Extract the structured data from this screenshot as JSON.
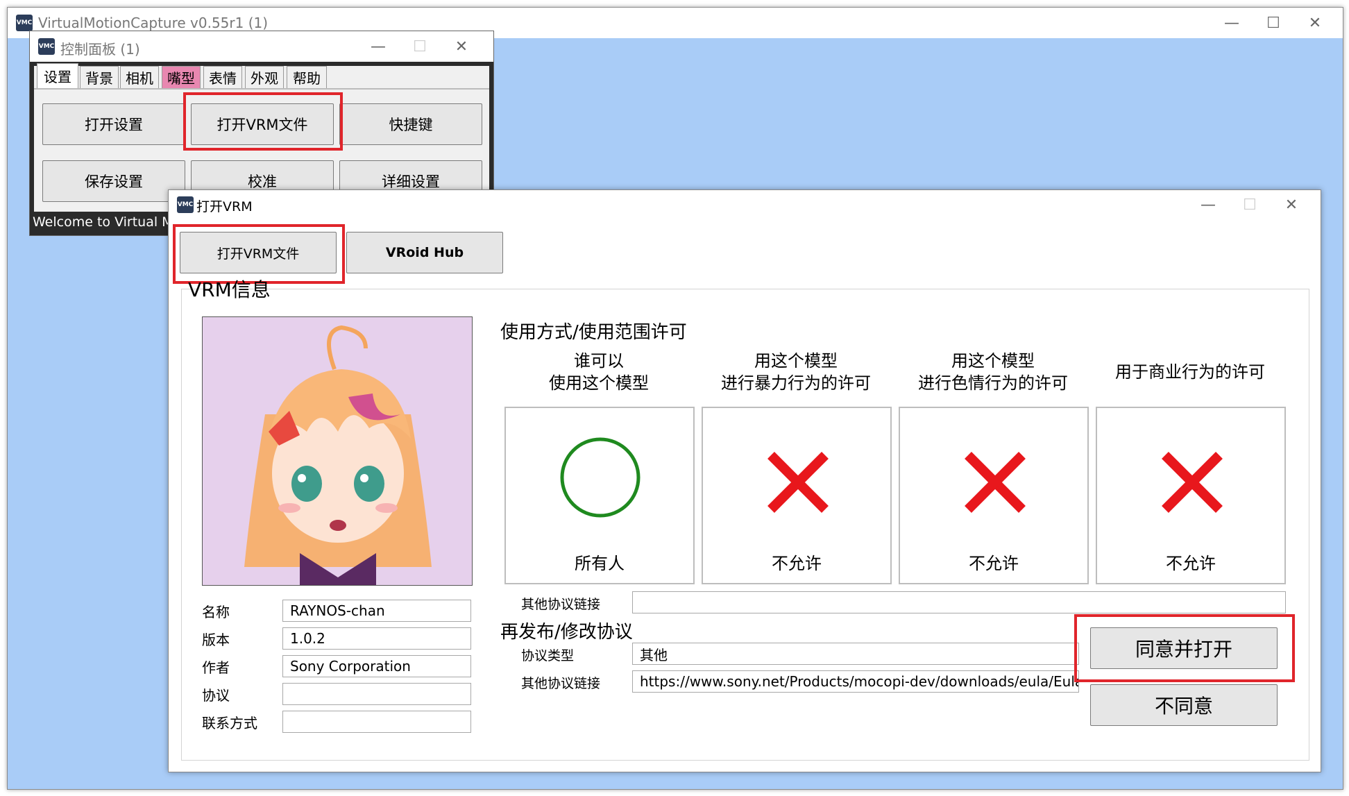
{
  "main_window": {
    "title": "VirtualMotionCapture v0.55r1 (1)",
    "minimize": "—",
    "maximize": "☐",
    "close": "✕"
  },
  "control_panel": {
    "title": "控制面板 (1)",
    "tabs": [
      {
        "label": "设置"
      },
      {
        "label": "背景"
      },
      {
        "label": "相机"
      },
      {
        "label": "嘴型"
      },
      {
        "label": "表情"
      },
      {
        "label": "外观"
      },
      {
        "label": "帮助"
      }
    ],
    "buttons": {
      "open_settings": "打开设置",
      "open_vrm": "打开VRM文件",
      "shortcuts": "快捷键",
      "save_settings": "保存设置",
      "calibrate": "校准",
      "detailed_settings": "详细设置"
    },
    "status_text": "Welcome to Virtual Mo"
  },
  "vrm_dialog": {
    "title": "打开VRM",
    "open_vrm_file_label": "打开VRM文件",
    "vroid_hub_label": "VRoid Hub",
    "group_title": "VRM信息",
    "info": {
      "name_label": "名称",
      "name_value": "RAYNOS-chan",
      "version_label": "版本",
      "version_value": "1.0.2",
      "author_label": "作者",
      "author_value": "Sony Corporation",
      "license_label": "协议",
      "license_value": "",
      "contact_label": "联系方式",
      "contact_value": ""
    },
    "usage_title": "使用方式/使用范围许可",
    "permissions": [
      {
        "header_line1": "谁可以",
        "header_line2": "使用这个模型",
        "icon": "allowed-circle-icon",
        "value": "所有人"
      },
      {
        "header_line1": "用这个模型",
        "header_line2": "进行暴力行为的许可",
        "icon": "denied-cross-icon",
        "value": "不允许"
      },
      {
        "header_line1": "用这个模型",
        "header_line2": "进行色情行为的许可",
        "icon": "denied-cross-icon",
        "value": "不允许"
      },
      {
        "header_line1": "用于商业行为的许可",
        "header_line2": "",
        "icon": "denied-cross-icon",
        "value": "不允许"
      }
    ],
    "other_license_link_label": "其他协议链接",
    "other_license_link_value": "",
    "redistribution_title": "再发布/修改协议",
    "license_type_label": "协议类型",
    "license_type_value": "其他",
    "redist_link_label": "其他协议链接",
    "redist_link_value": "https://www.sony.net/Products/mocopi-dev/downloads/eula/EulaC",
    "agree_label": "同意并打开",
    "disagree_label": "不同意",
    "colors": {
      "allowed": "#1f8a1f",
      "denied": "#e8171c",
      "highlight": "#e0252b"
    }
  }
}
